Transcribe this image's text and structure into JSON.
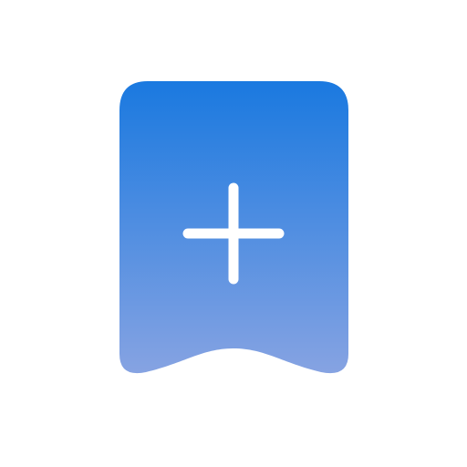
{
  "icon": {
    "name": "bookmark-add-icon",
    "gradient_top_color": "#1a79e0",
    "gradient_bottom_color": "#86a3e2",
    "plus_color": "#ffffff"
  }
}
